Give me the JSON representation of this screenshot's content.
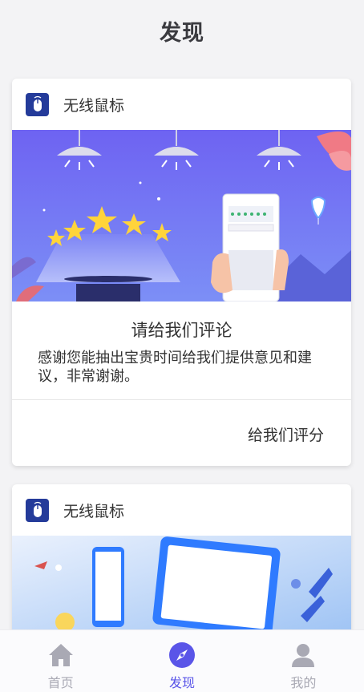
{
  "header": {
    "title": "发现"
  },
  "cards": [
    {
      "app_name": "无线鼠标",
      "title": "请给我们评论",
      "description": "感谢您能抽出宝贵时间给我们提供意见和建议，非常谢谢。",
      "action_label": "给我们评分"
    },
    {
      "app_name": "无线鼠标"
    }
  ],
  "tabbar": {
    "items": [
      {
        "label": "首页",
        "icon": "home-icon",
        "active": false
      },
      {
        "label": "发现",
        "icon": "compass-icon",
        "active": true
      },
      {
        "label": "我的",
        "icon": "user-icon",
        "active": false
      }
    ]
  },
  "colors": {
    "accent": "#5a55e8",
    "banner": "#6f78f5",
    "app_icon": "#243b9a"
  }
}
